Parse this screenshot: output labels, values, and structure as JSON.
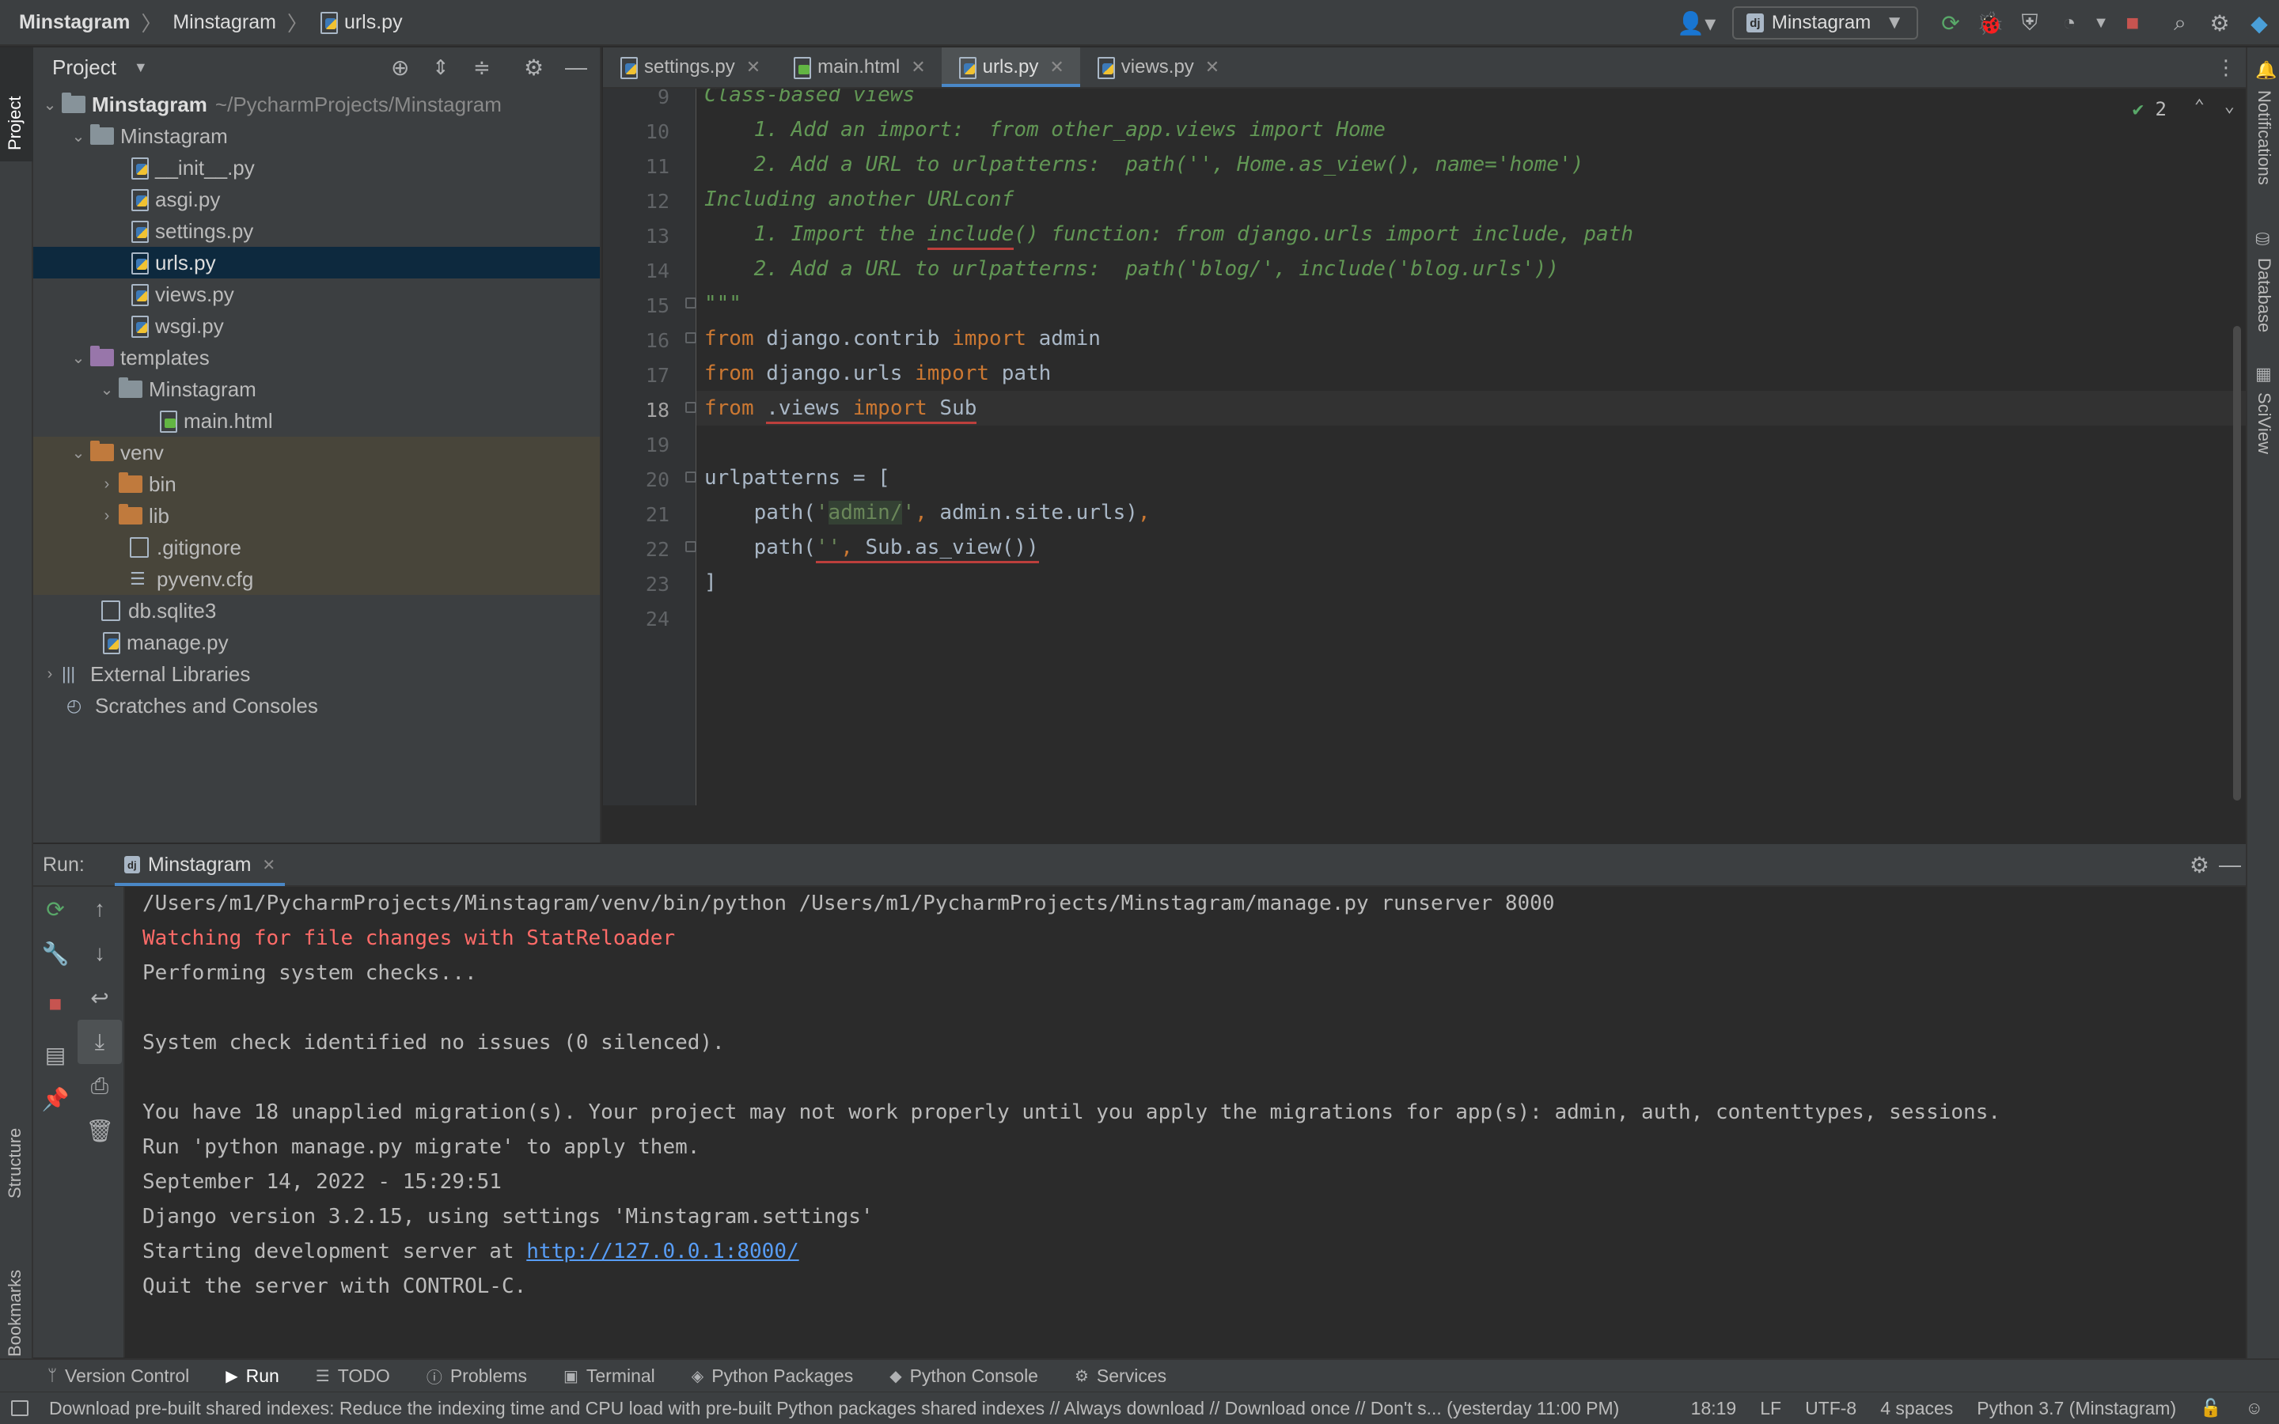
{
  "titlebar": {
    "project": "Minstagram",
    "module": "Minstagram",
    "file": "urls.py",
    "run_config": "Minstagram"
  },
  "project_panel": {
    "title": "Project",
    "root_name": "Minstagram",
    "root_path": "~/PycharmProjects/Minstagram",
    "items": {
      "pkg": "Minstagram",
      "init": "__init__.py",
      "asgi": "asgi.py",
      "settings": "settings.py",
      "urls": "urls.py",
      "views": "views.py",
      "wsgi": "wsgi.py",
      "templates": "templates",
      "templates_sub": "Minstagram",
      "main_html": "main.html",
      "venv": "venv",
      "bin": "bin",
      "lib": "lib",
      "gitignore": ".gitignore",
      "pyvenv": "pyvenv.cfg",
      "db": "db.sqlite3",
      "manage": "manage.py",
      "external": "External Libraries",
      "scratches": "Scratches and Consoles"
    }
  },
  "editor": {
    "tabs": [
      "settings.py",
      "main.html",
      "urls.py",
      "views.py"
    ],
    "active_tab": "urls.py",
    "inspection_count": "2",
    "line_numbers": [
      "9",
      "10",
      "11",
      "12",
      "13",
      "14",
      "15",
      "16",
      "17",
      "18",
      "19",
      "20",
      "21",
      "22",
      "23",
      "24"
    ]
  },
  "run": {
    "label": "Run:",
    "tab": "Minstagram",
    "console": {
      "l1": "/Users/m1/PycharmProjects/Minstagram/venv/bin/python /Users/m1/PycharmProjects/Minstagram/manage.py runserver 8000",
      "l2": "Watching for file changes with StatReloader",
      "l3": "Performing system checks...",
      "l4": "System check identified no issues (0 silenced).",
      "l5": "You have 18 unapplied migration(s). Your project may not work properly until you apply the migrations for app(s): admin, auth, contenttypes, sessions.",
      "l6": "Run 'python manage.py migrate' to apply them.",
      "l7": "September 14, 2022 - 15:29:51",
      "l8": "Django version 3.2.15, using settings 'Minstagram.settings'",
      "l9_prefix": "Starting development server at ",
      "l9_link": "http://127.0.0.1:8000/",
      "l10": "Quit the server with CONTROL-C."
    }
  },
  "side_labels": {
    "project": "Project",
    "structure": "Structure",
    "bookmarks": "Bookmarks",
    "notifications": "Notifications",
    "database": "Database",
    "sciview": "SciView"
  },
  "bottom_tools": [
    "Version Control",
    "Run",
    "TODO",
    "Problems",
    "Terminal",
    "Python Packages",
    "Python Console",
    "Services"
  ],
  "status": {
    "message": "Download pre-built shared indexes: Reduce the indexing time and CPU load with pre-built Python packages shared indexes // Always download // Download once // Don't s... (yesterday 11:00 PM)",
    "position": "18:19",
    "line_sep": "LF",
    "encoding": "UTF-8",
    "indent": "4 spaces",
    "interpreter": "Python 3.7 (Minstagram)"
  },
  "colors": {
    "keyword": "#cc7832",
    "string": "#6a8759",
    "docstring": "#629755",
    "error": "#ff6b68",
    "link": "#589df6",
    "accent": "#4a88c7"
  }
}
